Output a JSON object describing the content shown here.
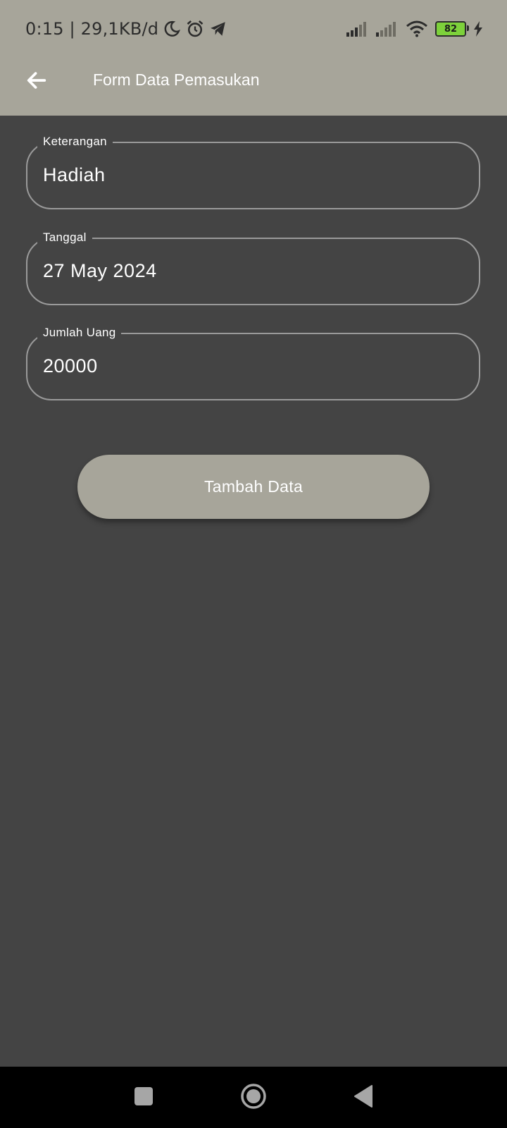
{
  "status_bar": {
    "time_info": "0:15 | 29,1KB/d",
    "icons": [
      "moon-icon",
      "alarm-icon",
      "telegram-icon",
      "signal-icon",
      "signal-icon",
      "wifi-icon",
      "battery-icon",
      "charging-icon"
    ],
    "battery_level": "82"
  },
  "app_bar": {
    "back_icon": "arrow-left-icon",
    "title": "Form Data Pemasukan"
  },
  "form": {
    "fields": [
      {
        "label": "Keterangan",
        "value": "Hadiah"
      },
      {
        "label": "Tanggal",
        "value": "27 May 2024"
      },
      {
        "label": "Jumlah Uang",
        "value": "20000"
      }
    ],
    "submit_label": "Tambah Data"
  },
  "nav_bar": {
    "buttons": [
      "recents-icon",
      "home-icon",
      "back-icon"
    ]
  },
  "colors": {
    "app_bar": "#a7a59a",
    "background": "#444444",
    "field_border": "#9a9a9a",
    "text": "#ffffff",
    "battery": "#7dd13b"
  }
}
